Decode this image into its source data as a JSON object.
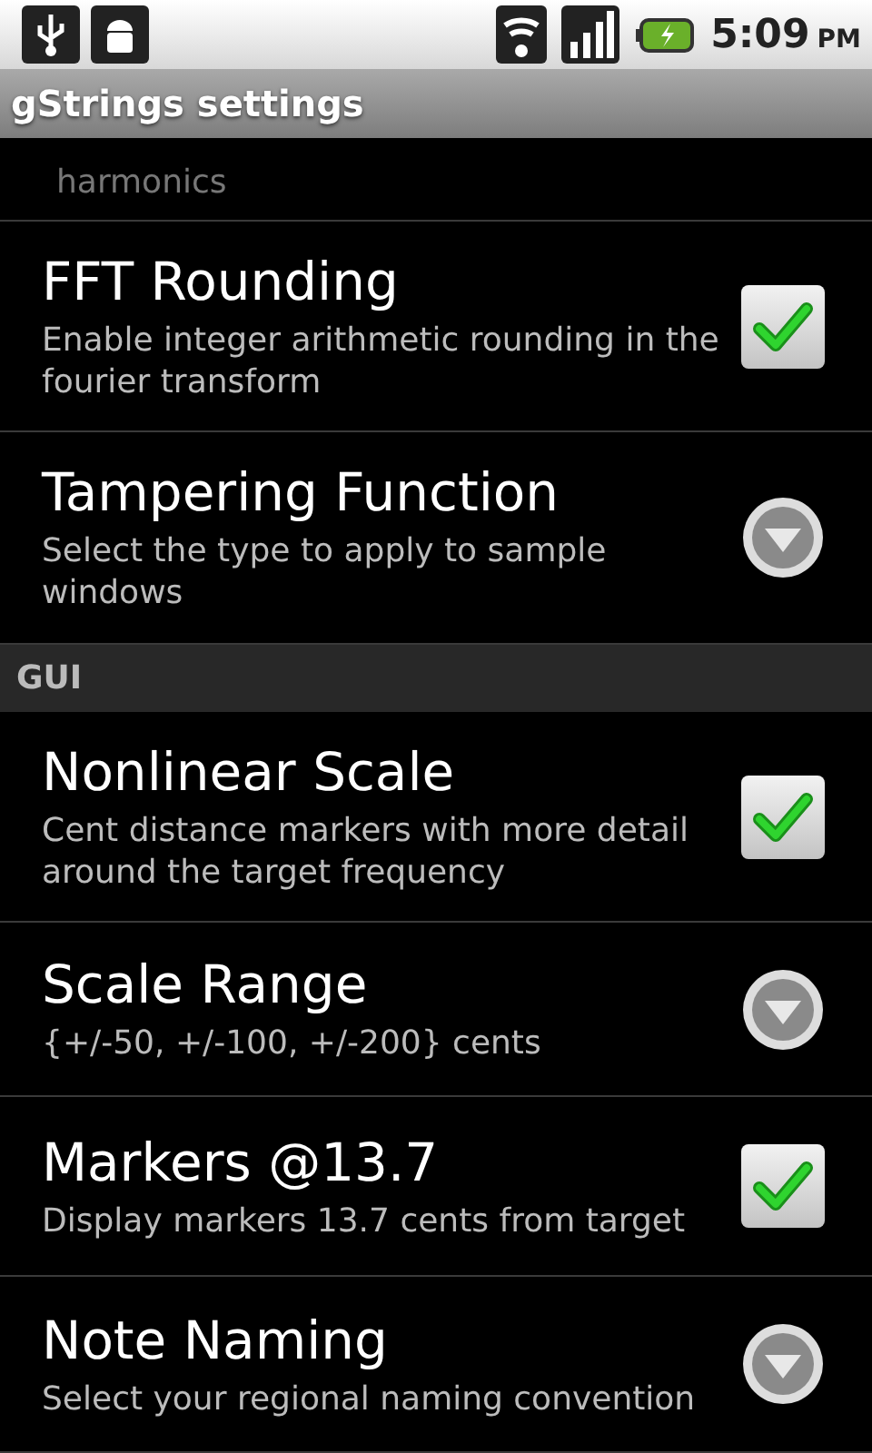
{
  "status_bar": {
    "time": "5:09",
    "ampm": "PM"
  },
  "title_bar": {
    "title": "gStrings settings"
  },
  "partial_summary": "harmonics",
  "items": [
    {
      "kind": "checkbox",
      "title": "FFT Rounding",
      "summary": "Enable integer arithmetic rounding in the fourier transform",
      "checked": true
    },
    {
      "kind": "list",
      "title": "Tampering Function",
      "summary": "Select the type to apply to sample windows"
    },
    {
      "kind": "header",
      "title": "GUI"
    },
    {
      "kind": "checkbox",
      "title": "Nonlinear Scale",
      "summary": "Cent distance markers with more detail around the target frequency",
      "checked": true
    },
    {
      "kind": "list",
      "title": "Scale Range",
      "summary": "{+/-50, +/-100, +/-200} cents"
    },
    {
      "kind": "checkbox",
      "title": "Markers @13.7",
      "summary": "Display markers 13.7 cents from target",
      "checked": true
    },
    {
      "kind": "list",
      "title": "Note Naming",
      "summary": "Select your regional naming convention"
    }
  ]
}
